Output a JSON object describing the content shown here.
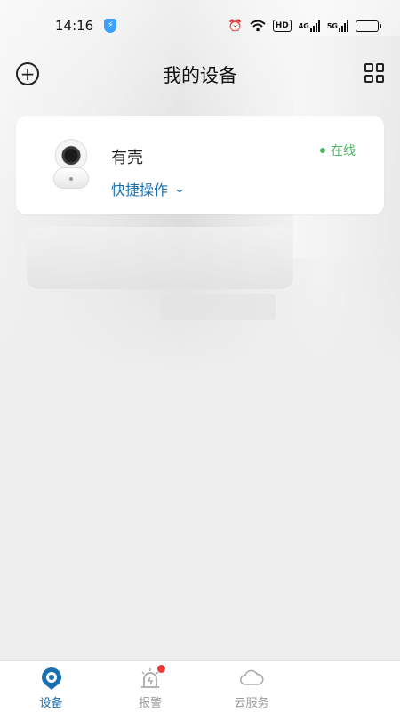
{
  "status_bar": {
    "time": "14:16",
    "icons": [
      "shield-icon",
      "alarm-icon",
      "wifi-icon",
      "hd-icon",
      "4g-signal-icon",
      "5g-signal-icon",
      "battery-icon"
    ],
    "hd_label": "HD",
    "net1": "4G",
    "net2": "5G"
  },
  "header": {
    "title": "我的设备",
    "left_icon": "add-circle-icon",
    "right_icon": "grid-view-icon"
  },
  "devices": [
    {
      "name": "有壳",
      "status": "在线",
      "status_color": "#4bb862",
      "quick_action_label": "快捷操作",
      "icon": "camera-icon"
    }
  ],
  "tabbar": {
    "tabs": [
      {
        "label": "设备",
        "icon": "device-icon",
        "active": true
      },
      {
        "label": "报警",
        "icon": "alarm-light-icon",
        "badge": true
      },
      {
        "label": "云服务",
        "icon": "cloud-icon"
      }
    ]
  },
  "colors": {
    "accent": "#1a6fb0",
    "online": "#4bb862",
    "badge": "#ea3a3a"
  }
}
